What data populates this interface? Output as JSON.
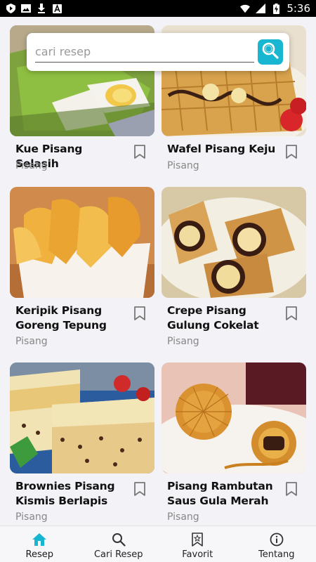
{
  "status_bar": {
    "time": "5:36",
    "battery_glyph": "battery-charging-icon"
  },
  "search": {
    "placeholder": "cari resep",
    "value": ""
  },
  "recipes": [
    {
      "title": "Kue Pisang Selasih",
      "category": "Pisang",
      "bookmarked": false
    },
    {
      "title": "Wafel Pisang Keju",
      "category": "Pisang",
      "bookmarked": false
    },
    {
      "title": "Keripik Pisang Goreng Tepung",
      "category": "Pisang",
      "bookmarked": false
    },
    {
      "title": "Crepe Pisang Gulung Cokelat",
      "category": "Pisang",
      "bookmarked": false
    },
    {
      "title": "Brownies Pisang Kismis Berlapis",
      "category": "Pisang",
      "bookmarked": false
    },
    {
      "title": "Pisang Rambutan Saus Gula Merah",
      "category": "Pisang",
      "bookmarked": false
    }
  ],
  "bottom_nav": {
    "active": "Resep",
    "items": [
      {
        "label": "Resep",
        "icon": "home-icon"
      },
      {
        "label": "Cari Resep",
        "icon": "search-icon"
      },
      {
        "label": "Favorit",
        "icon": "favorite-bookmark-icon"
      },
      {
        "label": "Tentang",
        "icon": "info-icon"
      }
    ]
  },
  "colors": {
    "accent": "#19b6d2",
    "background": "#f2f2f7",
    "title_text": "#111111",
    "category_text": "#888888"
  }
}
